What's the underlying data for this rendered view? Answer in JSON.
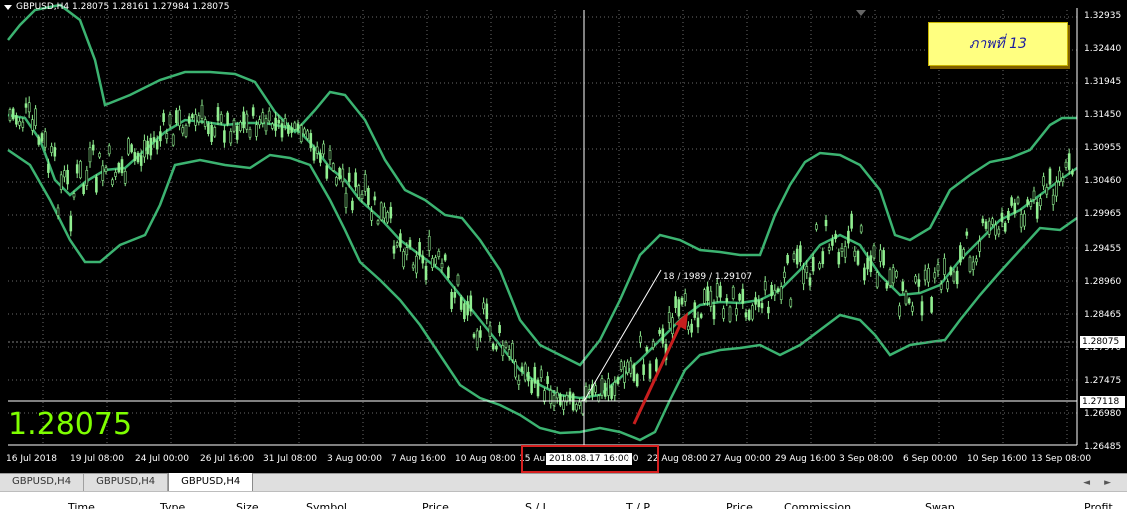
{
  "chart": {
    "info_text": "GBPUSD,H4  1.28075 1.28161 1.27984 1.28075",
    "big_price": "1.28075",
    "note_text": "ภาพที่ 13",
    "price_scale": [
      "1.32935",
      "1.32440",
      "1.31945",
      "1.31450",
      "1.30955",
      "1.30460",
      "1.29965",
      "1.29455",
      "1.28960",
      "1.28465",
      "1.27970",
      "1.27475",
      "1.26980",
      "1.26485"
    ],
    "current_price_badge": "1.28075",
    "line_price_badge": "1.27118",
    "time_scale": [
      "16 Jul 2018",
      "19 Jul 08:00",
      "24 Jul 00:00",
      "26 Jul 16:00",
      "31 Jul 08:00",
      "3 Aug 00:00",
      "7 Aug 16:00",
      "10 Aug 08:00",
      "15 Au",
      "2018.08.17 16:00",
      ":00",
      "22 Aug 08:00",
      "27 Aug 00:00",
      "29 Aug 16:00",
      "3 Sep 08:00",
      "6 Sep 00:00",
      "10 Sep 16:00",
      "13 Sep 08:00"
    ],
    "trendline_label": "18 / 1989 / 1.29107",
    "colors": {
      "background": "#000000",
      "candles": "#90ee90",
      "bands": "#3cb371",
      "price_text": "#7fff00",
      "arrow": "#c81e1e",
      "highlight": "#d61f1f",
      "note_bg": "#ffff80",
      "note_text": "#1a1aa0"
    }
  },
  "tabs": [
    {
      "label": "GBPUSD,H4",
      "active": false
    },
    {
      "label": "GBPUSD,H4",
      "active": false
    },
    {
      "label": "GBPUSD,H4",
      "active": true
    }
  ],
  "tab_scroll": {
    "left_icon": "◄",
    "right_icon": "►"
  },
  "terminal": {
    "columns": [
      "Time",
      "Type",
      "Size",
      "Symbol",
      "Price",
      "S / L",
      "T / P",
      "Price",
      "Commission",
      "Swap",
      "Profit"
    ]
  }
}
